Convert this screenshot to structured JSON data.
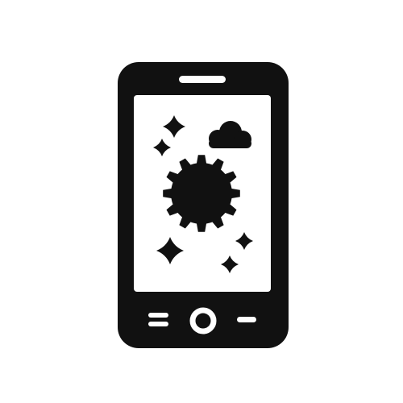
{
  "icon": {
    "name": "smartphone-settings-icon",
    "colors": {
      "foreground": "#111111",
      "screen": "#ffffff",
      "background": "#ffffff"
    },
    "parts": [
      "speaker-slot",
      "screen",
      "gear",
      "cloud",
      "sparkles",
      "menu-button",
      "home-button",
      "back-button"
    ]
  }
}
